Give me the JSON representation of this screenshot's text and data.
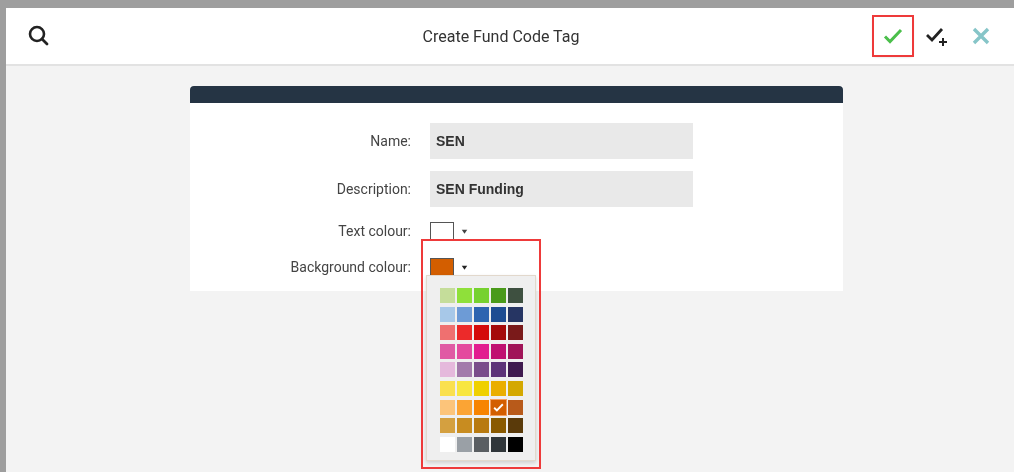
{
  "header": {
    "title": "Create Fund Code Tag",
    "actions": [
      {
        "kind": "save",
        "highlighted": true
      },
      {
        "kind": "save-add",
        "highlighted": false
      },
      {
        "kind": "cancel",
        "highlighted": false
      }
    ]
  },
  "form": {
    "fields": [
      {
        "kind": "text",
        "label": "Name:",
        "value": "SEN"
      },
      {
        "kind": "text",
        "label": "Description:",
        "value": "SEN Funding"
      },
      {
        "kind": "colour",
        "label": "Text colour:",
        "color": "#ffffff",
        "open": false
      },
      {
        "kind": "colour",
        "label": "Background colour:",
        "color": "#d35e00",
        "open": true,
        "highlighted": true
      }
    ]
  },
  "palette": [
    {
      "color": "#c5dd9a",
      "selected": false
    },
    {
      "color": "#8fe03a",
      "selected": false
    },
    {
      "color": "#76d12f",
      "selected": false
    },
    {
      "color": "#4a9a1a",
      "selected": false
    },
    {
      "color": "#3e5040",
      "selected": false
    },
    {
      "color": "#a7c8e8",
      "selected": false
    },
    {
      "color": "#6d9bd6",
      "selected": false
    },
    {
      "color": "#2d64b0",
      "selected": false
    },
    {
      "color": "#1e4c92",
      "selected": false
    },
    {
      "color": "#263563",
      "selected": false
    },
    {
      "color": "#ef7070",
      "selected": false
    },
    {
      "color": "#ec2a2a",
      "selected": false
    },
    {
      "color": "#d40b0b",
      "selected": false
    },
    {
      "color": "#a50a0a",
      "selected": false
    },
    {
      "color": "#7a1a1a",
      "selected": false
    },
    {
      "color": "#e05aa4",
      "selected": false
    },
    {
      "color": "#e44a9e",
      "selected": false
    },
    {
      "color": "#e21d8f",
      "selected": false
    },
    {
      "color": "#c01070",
      "selected": false
    },
    {
      "color": "#a01458",
      "selected": false
    },
    {
      "color": "#e5b9dc",
      "selected": false
    },
    {
      "color": "#a37aab",
      "selected": false
    },
    {
      "color": "#7a4d8a",
      "selected": false
    },
    {
      "color": "#5d3378",
      "selected": false
    },
    {
      "color": "#3f1a4f",
      "selected": false
    },
    {
      "color": "#fae04e",
      "selected": false
    },
    {
      "color": "#f8e640",
      "selected": false
    },
    {
      "color": "#efd000",
      "selected": false
    },
    {
      "color": "#eaae00",
      "selected": false
    },
    {
      "color": "#d4a800",
      "selected": false
    },
    {
      "color": "#fcc47a",
      "selected": false
    },
    {
      "color": "#fba434",
      "selected": false
    },
    {
      "color": "#f78400",
      "selected": false
    },
    {
      "color": "#d35e00",
      "selected": true
    },
    {
      "color": "#b85a1a",
      "selected": false
    },
    {
      "color": "#d4a040",
      "selected": false
    },
    {
      "color": "#c88c20",
      "selected": false
    },
    {
      "color": "#b87a10",
      "selected": false
    },
    {
      "color": "#8a5a00",
      "selected": false
    },
    {
      "color": "#5a3a0a",
      "selected": false
    },
    {
      "color": "#ffffff",
      "selected": false
    },
    {
      "color": "#9aa0a6",
      "selected": false
    },
    {
      "color": "#5a5e62",
      "selected": false
    },
    {
      "color": "#30363a",
      "selected": false
    },
    {
      "color": "#000000",
      "selected": false
    }
  ]
}
